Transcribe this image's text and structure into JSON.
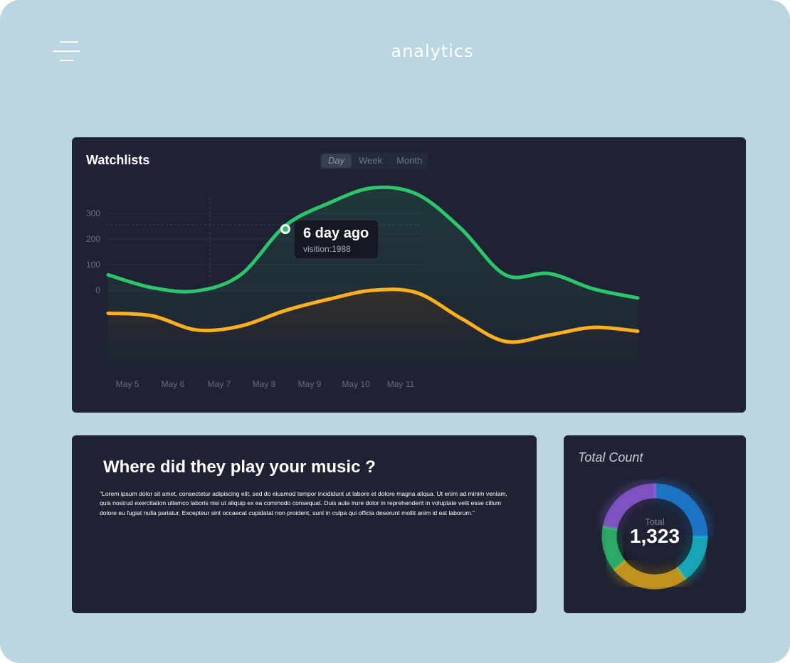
{
  "header": {
    "title": "analytics",
    "menu_icon": "hamburger-menu-icon"
  },
  "watchlists": {
    "title": "Watchlists",
    "tabs": [
      {
        "label": "Day",
        "active": true
      },
      {
        "label": "Week",
        "active": false
      },
      {
        "label": "Month",
        "active": false
      }
    ],
    "tooltip": {
      "title": "6 day ago",
      "subtitle": "visition:1988"
    }
  },
  "chart_data": {
    "type": "area",
    "title": "Watchlists",
    "categories": [
      "May 5",
      "May 6",
      "May 7",
      "May 8",
      "May 9",
      "May 10",
      "May 11"
    ],
    "yticks": [
      0,
      100,
      200,
      300
    ],
    "grid": true,
    "series": [
      {
        "color": "#2ec46b",
        "values": [
          60,
          10,
          -3,
          60,
          250,
          340,
          400,
          375,
          240,
          60,
          65,
          5,
          -30
        ]
      },
      {
        "color": "#fdb01d",
        "values": [
          -90,
          -100,
          -155,
          -140,
          -80,
          -35,
          0,
          -10,
          -110,
          -200,
          -175,
          -145,
          -160
        ]
      }
    ]
  },
  "music": {
    "title": "Where did they play your music ?",
    "body": "\"Lorem ipsum dolor sit amet, consectetur adipiscing elit, sed do eiusmod tempor incididunt ut labore et dolore magna aliqua. Ut enim ad minim veniam, quis nostrud exercitation ullamco laboris nisi ut aliquip ex ea commodo consequat. Duis aute irure dolor in reprehenderit in voluptate velit esse cillum dolore eu fugiat nulla pariatur. Excepteur sint occaecat cupidatat non proident, sunt in culpa qui officia deserunt mollit anim id est laborum.\""
  },
  "total_count": {
    "title": "Total Count",
    "label": "Total",
    "value": "1,323",
    "segments": [
      {
        "name": "blue",
        "color": "#1e7fd8",
        "fraction": 0.25
      },
      {
        "name": "teal",
        "color": "#17b8c9",
        "fraction": 0.15
      },
      {
        "name": "gold",
        "color": "#d8a21c",
        "fraction": 0.24
      },
      {
        "name": "green",
        "color": "#2ebd6d",
        "fraction": 0.14
      },
      {
        "name": "purple",
        "color": "#8c5ad6",
        "fraction": 0.22
      }
    ]
  }
}
